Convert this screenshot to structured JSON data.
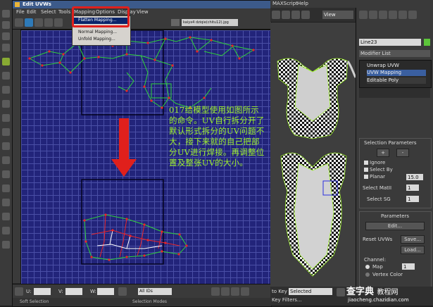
{
  "uvw_window": {
    "title": "Edit UVWs",
    "menu": [
      "File",
      "Edit",
      "Select",
      "Tools",
      "Mapping",
      "Options",
      "Display",
      "View"
    ],
    "texture_dropdown": "kaiyx4 dziqie(chitu12).jpg"
  },
  "mapping_menu": {
    "items": [
      "Flatten Mapping...",
      "Normal Mapping...",
      "Unfold Mapping..."
    ]
  },
  "bottom_bar": {
    "u_label": "U:",
    "v_label": "V:",
    "w_label": "W:",
    "ids_select": "All IDs"
  },
  "status_bar": {
    "left": "Soft Selection",
    "right": "Selection Modes"
  },
  "overlay_text": {
    "lines": [
      "017给模型使用如图所示",
      "的命令。UV自行拆分开了",
      "默认形式拆分的UV问题不",
      "大，接下来就的自己把部",
      "分UV进行焊接。再调整位",
      "置及整张UV的大小。"
    ]
  },
  "max_menubar": {
    "items": [
      "MAXScript",
      "Help"
    ]
  },
  "viewport_toolbar": {
    "view_label": "View"
  },
  "command_panel": {
    "object_name": "Line23",
    "modifier_list": "Modifier List",
    "stack": [
      "Unwrap UVW",
      "UVW Mapping",
      "Editable Poly"
    ],
    "selection_parameters": {
      "title": "Selection Parameters",
      "plus": "+",
      "minus": "-",
      "ignore": "Ignore",
      "select_by": "Select By",
      "planar": "Planar",
      "planar_value": "15.0",
      "select_matid": "Select MatII",
      "select_matid_value": "1",
      "select_sg": "Select SG",
      "select_sg_value": "1"
    },
    "parameters": {
      "title": "Parameters",
      "edit": "Edit...",
      "reset_uvws": "Reset UVWs",
      "save": "Save...",
      "load": "Load...",
      "channel": "Channel:",
      "map": "Map",
      "map_value": "1",
      "vertex_color": "Vertex Color"
    }
  },
  "bottom_right": {
    "key_label": "to Key",
    "key_value": "Selected",
    "key_filters": "Key Filters..."
  },
  "watermark": {
    "main": "查字典",
    "sub": "教程网",
    "url": "jiaocheng.chazidian.com"
  },
  "colors": {
    "grid_bg": "#22247a",
    "uv_edge": "#2fd23a",
    "uv_vertex": "#e8242a",
    "overlay_text": "#9ef02c",
    "arrow": "#e0201c"
  }
}
